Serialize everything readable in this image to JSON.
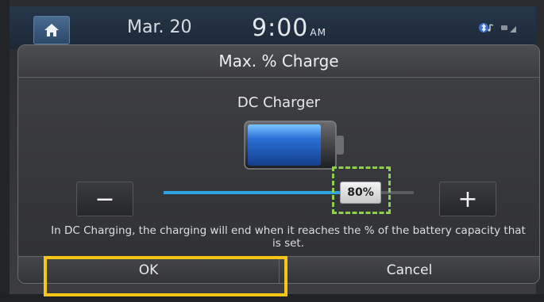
{
  "status_bar": {
    "date": "Mar. 20",
    "time": "9:00",
    "ampm": "AM"
  },
  "dialog": {
    "title": "Max. % Charge",
    "subtitle": "DC Charger",
    "slider": {
      "value_label": "80%",
      "value": 80
    },
    "info_text": "In DC Charging, the charging will end when it reaches the % of the battery capacity that is set.",
    "ok_label": "OK",
    "cancel_label": "Cancel",
    "minus_label": "−",
    "plus_label": "+"
  },
  "colors": {
    "slider_fill": "#2ea3e6",
    "battery_fill": "#2a6fd6",
    "highlight_green": "#8fd14f",
    "highlight_orange": "#f5c518"
  }
}
